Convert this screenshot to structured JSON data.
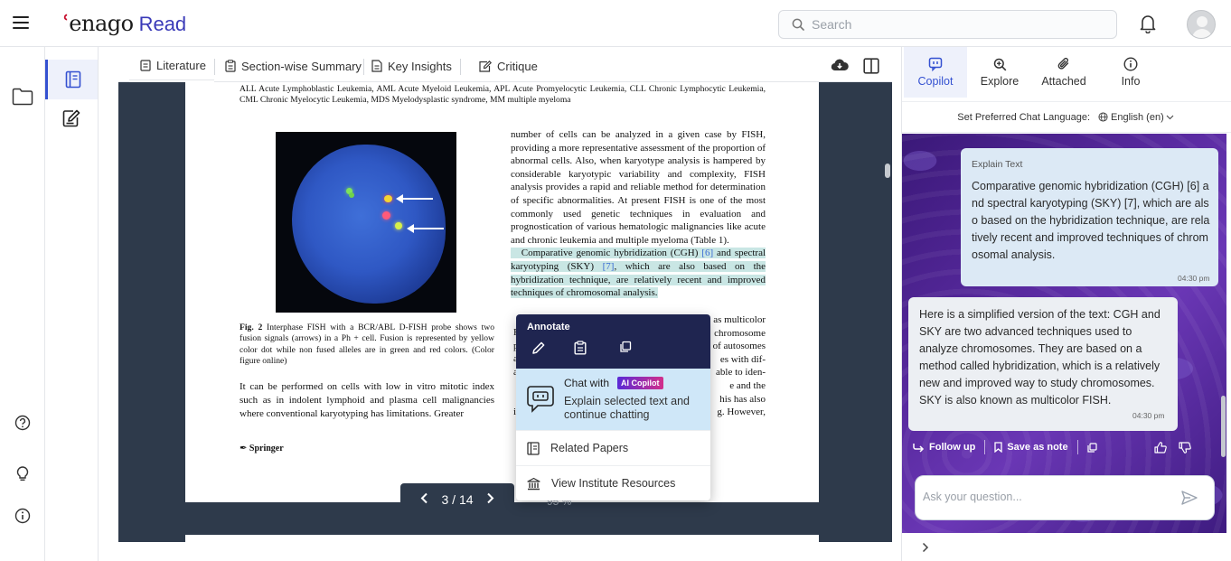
{
  "header": {
    "logo_mark": "ʿ",
    "logo_text": "enago",
    "logo_suffix": "Read",
    "search_placeholder": "Search"
  },
  "viewer": {
    "tabs": [
      {
        "label": "Literature",
        "active": true
      },
      {
        "label": "Section-wise Summary",
        "active": false
      },
      {
        "label": "Key Insights",
        "active": false
      },
      {
        "label": "Critique",
        "active": false
      }
    ],
    "pager": {
      "current": "3 / 14"
    },
    "zoom": "95 %"
  },
  "pdf": {
    "abbreviations": "ALL Acute Lymphoblastic Leukemia, AML Acute Myeloid Leukemia, APL Acute Promyelocytic Leukemia, CLL Chronic Lymphocytic Leukemia, CML Chronic Myelocytic Leukemia, MDS Myelodysplastic syndrome, MM multiple myeloma",
    "caption_label": "Fig. 2",
    "caption_text": "Interphase FISH with a BCR/ABL D-FISH probe shows two fusion signals (arrows) in a Ph + cell. Fusion is represented by yellow color dot while non fused alleles are in green and red colors. (Color figure online)",
    "left_para": "It can be performed on cells with low in vitro mitotic index such as in indolent lymphoid and plasma cell malignancies where conventional karyotyping has limitations. Greater",
    "publisher": "Springer",
    "right_para": "number of cells can be analyzed in a given case by FISH, providing a more representative assessment of the proportion of abnormal cells. Also, when karyotype analysis is hampered by considerable karyotypic variability and complexity, FISH analysis provides a rapid and reliable method for determination of specific abnormalities. At present FISH is one of the most commonly used genetic techniques in evaluation and prognostication of various hematologic malignancies like acute and chronic leukemia and multiple myeloma (Table 1).",
    "highlight_a": "Comparative genomic hybridization (CGH)",
    "cite_6": "[6]",
    "highlight_b": "and spectral karyotyping (SKY)",
    "cite_7": "[7]",
    "highlight_c": ", which are also based on the hybridization technique, are relatively recent and improved techniques of chromosomal analysis.",
    "peek_right": [
      "as multicolor",
      "chromosome",
      "of autosomes",
      "es with dif-",
      "able to iden-",
      "e and the",
      "his has also",
      "g. However,"
    ],
    "peek_left": [
      "F",
      "p",
      "a",
      "a",
      "",
      "",
      "i"
    ]
  },
  "popup": {
    "title": "Annotate",
    "chat_with": "Chat with",
    "badge": "AI Copilot",
    "chat_desc": "Explain selected text and continue chatting",
    "related": "Related Papers",
    "institute": "View Institute Resources"
  },
  "right_panel": {
    "tabs": [
      {
        "label": "Copilot",
        "active": true
      },
      {
        "label": "Explore",
        "active": false
      },
      {
        "label": "Attached",
        "active": false
      },
      {
        "label": "Info",
        "active": false
      }
    ],
    "lang_label": "Set Preferred Chat Language:",
    "lang_value": "English (en)",
    "user_msg": {
      "label": "Explain Text",
      "text": "Comparative genomic hybridization (CGH) [6] and spectral karyotyping (SKY) [7], which are also based on the hybridization technique, are relatively recent and improved techniques of chromosomal analysis.",
      "time": "04:30 pm"
    },
    "bot_msg": {
      "text": "Here is a simplified version of the text: CGH and SKY are two advanced techniques used to analyze chromosomes. They are based on a method called hybridization, which is a relatively new and improved way to study chromosomes. SKY is also known as multicolor FISH.",
      "time": "04:30 pm"
    },
    "actions": {
      "follow_up": "Follow up",
      "save_note": "Save as note"
    },
    "ask_placeholder": "Ask your question..."
  },
  "colors": {
    "accent": "#3451d1",
    "popup_header": "#1f2550",
    "viewer_bg": "#2e3a4b"
  }
}
